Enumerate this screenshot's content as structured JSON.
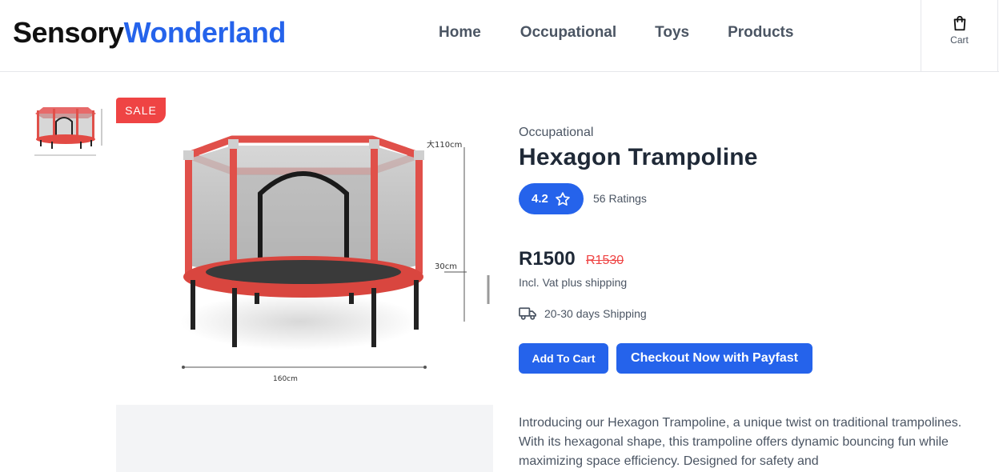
{
  "header": {
    "logo_part1": "Sensory",
    "logo_part2": "Wonderland",
    "nav": [
      "Home",
      "Occupational",
      "Toys",
      "Products"
    ],
    "cart_label": "Cart"
  },
  "gallery": {
    "sale_badge": "SALE",
    "dim_height": "大110cm",
    "dim_leg": "30cm",
    "dim_width": "160cm"
  },
  "product": {
    "category": "Occupational",
    "title": "Hexagon Trampoline",
    "rating": "4.2",
    "ratings_count": "56 Ratings",
    "price": "R1500",
    "old_price": "R1530",
    "vat_note": "Incl. Vat plus shipping",
    "shipping": "20-30 days Shipping",
    "add_to_cart": "Add To Cart",
    "checkout": "Checkout Now with Payfast",
    "description": "Introducing our Hexagon Trampoline, a unique twist on traditional trampolines. With its hexagonal shape, this trampoline offers dynamic bouncing fun while maximizing space efficiency. Designed for safety and"
  },
  "colors": {
    "brand_blue": "#2563eb",
    "sale_red": "#ef4444",
    "text_dark": "#1f2937",
    "text_muted": "#4b5563"
  },
  "icons": {
    "cart": "shopping-bag-icon",
    "rating": "star-icon",
    "shipping": "truck-icon"
  }
}
